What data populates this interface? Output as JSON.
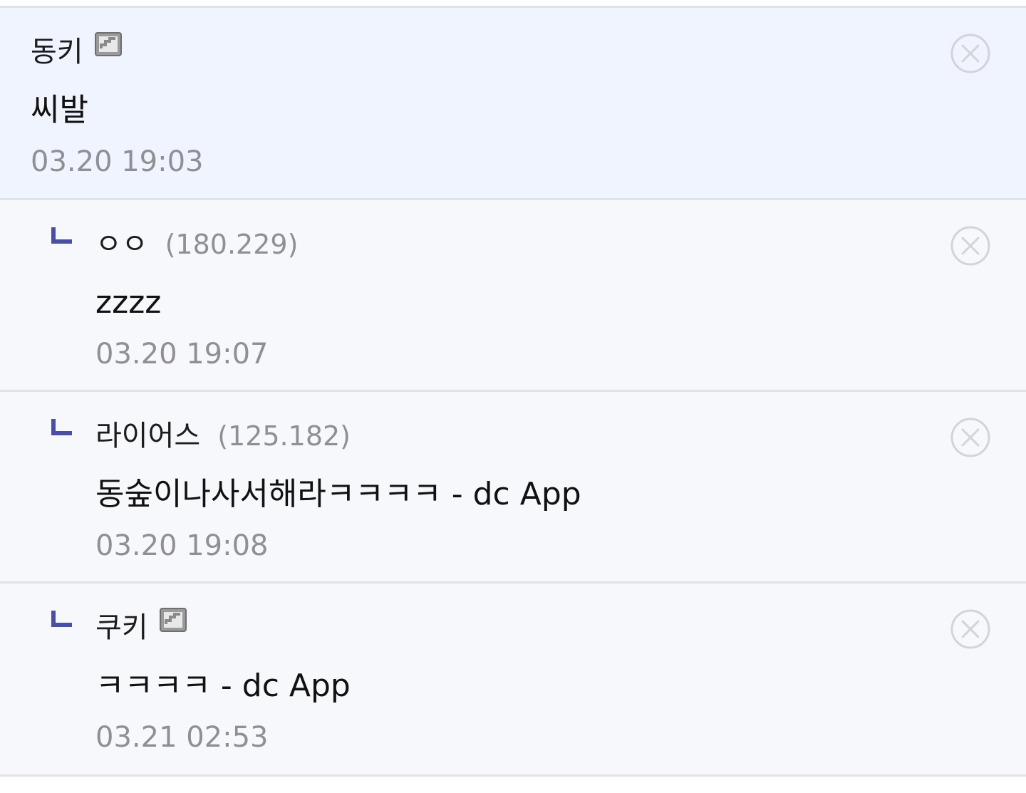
{
  "colors": {
    "highlight_bg": "#f0f4fe",
    "reply_bg": "#f7f8fc",
    "divider": "#dfe2ea",
    "reply_mark": "#4b4fa3",
    "muted_text": "#8f8f94",
    "delete_icon": "#d3d3d9"
  },
  "icons": {
    "gallog": "fixed-nick-gallog-icon",
    "reply": "reply-arrow-icon",
    "delete": "circle-x-icon"
  },
  "comments": [
    {
      "nickname": "동키",
      "ip": "",
      "text": "씨발",
      "time": "03.20 19:03"
    },
    {
      "nickname": "ㅇㅇ",
      "ip": "(180.229)",
      "text": "zzzz",
      "time": "03.20 19:07"
    },
    {
      "nickname": "라이어스",
      "ip": "(125.182)",
      "text": "동숲이나사서해라ㅋㅋㅋㅋ - dc App",
      "time": "03.20 19:08"
    },
    {
      "nickname": "쿠키",
      "ip": "",
      "text": "ㅋㅋㅋㅋ - dc App",
      "time": "03.21 02:53"
    }
  ]
}
